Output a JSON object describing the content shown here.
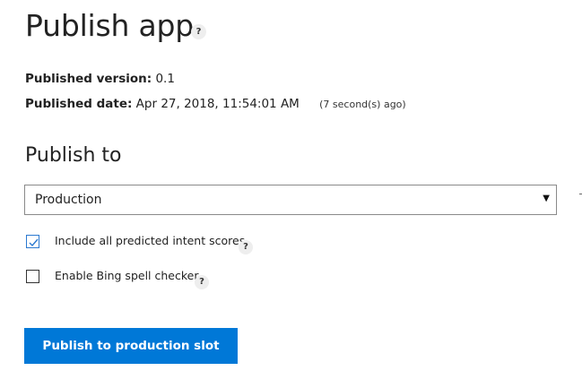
{
  "header": {
    "title": "Publish app",
    "help_glyph": "?"
  },
  "info": {
    "version_label": "Published version:",
    "version_value": "0.1",
    "date_label": "Published date:",
    "date_value": "Apr 27, 2018, 11:54:01 AM",
    "date_ago": "(7 second(s) ago)"
  },
  "publish_to": {
    "title": "Publish to",
    "selected": "Production",
    "arrow_glyph": "▼"
  },
  "options": {
    "include_scores": {
      "label": "Include all predicted intent scores",
      "checked": true,
      "help_glyph": "?"
    },
    "bing_spell": {
      "label": "Enable Bing spell checker",
      "checked": false,
      "help_glyph": "?"
    }
  },
  "actions": {
    "publish_label": "Publish to production slot"
  },
  "colors": {
    "accent": "#0078d7",
    "checkbox_checked": "#2b79d0",
    "help_badge_bg": "#eeeeee"
  },
  "icons": {
    "help": "question-mark-icon",
    "dropdown": "chevron-down-icon",
    "check": "checkmark-icon"
  }
}
